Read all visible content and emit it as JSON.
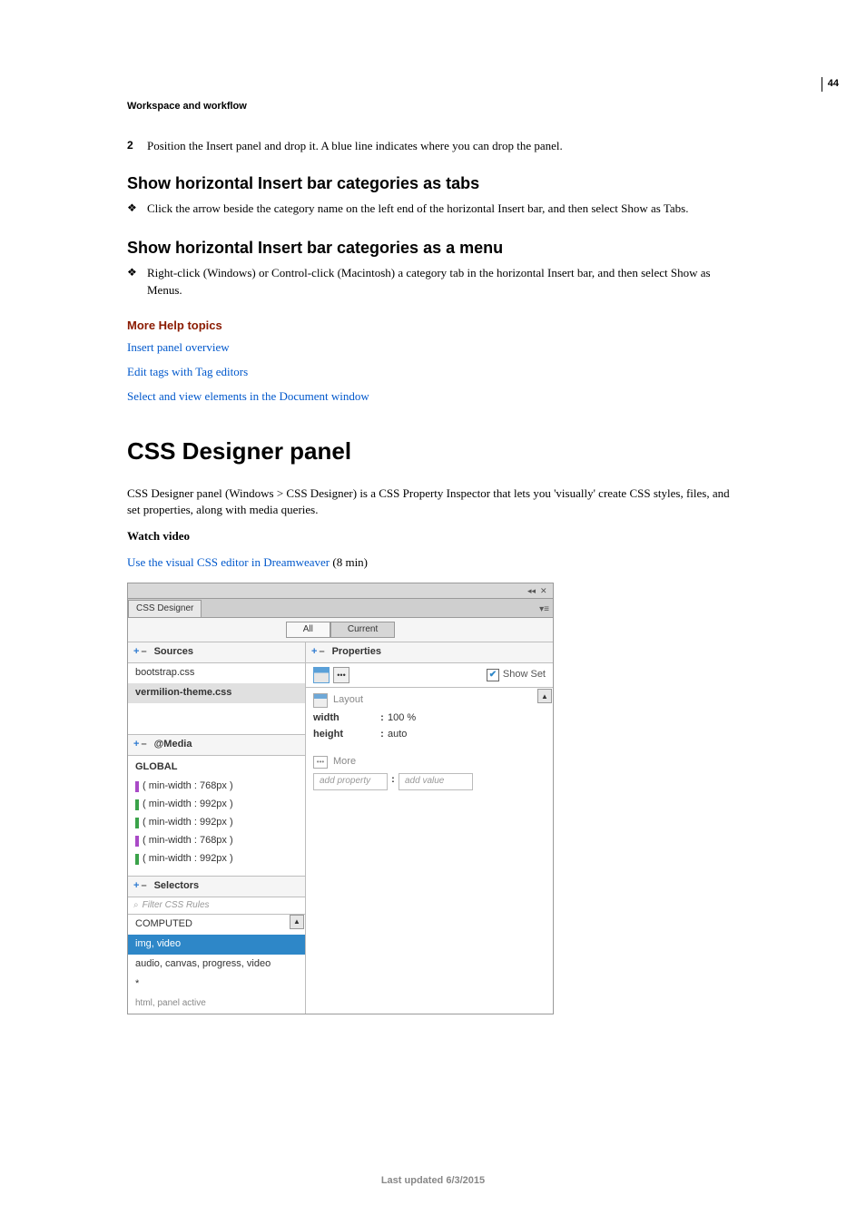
{
  "page_number": "44",
  "breadcrumb": "Workspace and workflow",
  "step2": {
    "num": "2",
    "text": "Position the Insert panel and drop it. A blue line indicates where you can drop the panel."
  },
  "sec1": {
    "title": "Show horizontal Insert bar categories as tabs",
    "bullet": "Click the arrow beside the category name on the left end of the horizontal Insert bar, and then select Show as Tabs."
  },
  "sec2": {
    "title": "Show horizontal Insert bar categories as a menu",
    "bullet": "Right-click (Windows) or Control-click (Macintosh) a category tab in the horizontal Insert bar, and then select Show as Menus."
  },
  "help": {
    "title": "More Help topics",
    "links": [
      "Insert panel overview",
      "Edit tags with Tag editors",
      "Select and view elements in the Document window"
    ]
  },
  "h1": "CSS Designer panel",
  "intro": "CSS Designer panel (Windows > CSS Designer) is a CSS Property Inspector that lets you 'visually' create CSS styles, files, and set properties, along with media queries.",
  "watch_label": "Watch video",
  "video": {
    "link": "Use the visual CSS editor in Dreamweaver",
    "duration": " (8 min)"
  },
  "footer": "Last updated 6/3/2015",
  "bullet_symbol": "❖",
  "panel": {
    "tab": "CSS Designer",
    "subtabs": {
      "all": "All",
      "current": "Current"
    },
    "sources": {
      "title": "Sources",
      "items": [
        "bootstrap.css",
        "vermilion-theme.css"
      ]
    },
    "media": {
      "title": "@Media",
      "global": "GLOBAL",
      "items": [
        "( min-width : 768px )",
        "( min-width : 992px )",
        "( min-width : 992px )",
        "( min-width : 768px )",
        "( min-width : 992px )"
      ]
    },
    "selectors": {
      "title": "Selectors",
      "filter": "Filter CSS Rules",
      "items": [
        "COMPUTED",
        "img, video",
        "audio, canvas, progress, video",
        "*"
      ],
      "partial": "html, panel active"
    },
    "properties": {
      "title": "Properties",
      "showset": "Show Set",
      "layout_label": "Layout",
      "rows": [
        {
          "name": "width",
          "val": "100 %"
        },
        {
          "name": "height",
          "val": "auto"
        }
      ],
      "more_label": "More",
      "add_property": "add property",
      "add_value": "add value"
    }
  }
}
